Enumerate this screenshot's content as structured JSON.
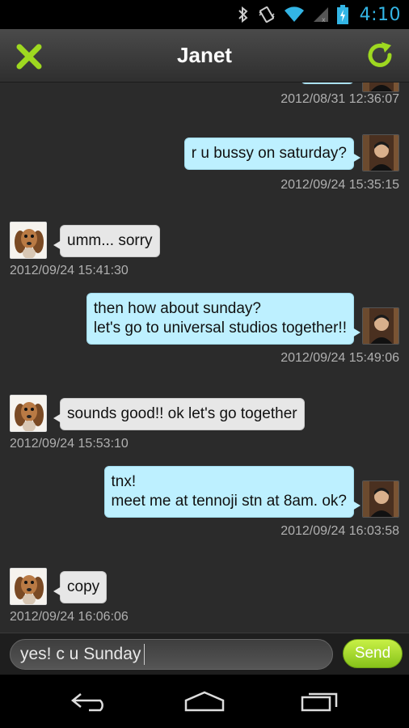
{
  "status_bar": {
    "time": "4:10",
    "icons": [
      "bluetooth-icon",
      "vibrate-icon",
      "wifi-icon",
      "signal-icon",
      "battery-charging-icon"
    ],
    "accent_color": "#33b5e5"
  },
  "header": {
    "title": "Janet",
    "close_icon": "close-icon",
    "refresh_icon": "refresh-icon",
    "icon_color": "#9ed820"
  },
  "messages": [
    {
      "from": "me",
      "lines": [],
      "time": "2012/08/31 12:36:07",
      "partial": true
    },
    {
      "from": "me",
      "lines": [
        "r u bussy on saturday?"
      ],
      "time": "2012/09/24 15:35:15"
    },
    {
      "from": "janet",
      "lines": [
        "umm... sorry"
      ],
      "time": "2012/09/24 15:41:30"
    },
    {
      "from": "me",
      "lines": [
        "then how about sunday?",
        "let's go to universal studios together!!"
      ],
      "time": "2012/09/24 15:49:06"
    },
    {
      "from": "janet",
      "lines": [
        "sounds good!! ok let's go together"
      ],
      "time": "2012/09/24 15:53:10"
    },
    {
      "from": "me",
      "lines": [
        "tnx!",
        "meet me at tennoji stn at 8am. ok?"
      ],
      "time": "2012/09/24 16:03:58"
    },
    {
      "from": "janet",
      "lines": [
        "copy"
      ],
      "time": "2012/09/24 16:06:06"
    }
  ],
  "composer": {
    "value": "yes! c u Sunday",
    "send_label": "Send",
    "send_color": "#9ed820"
  },
  "nav_bar": {
    "buttons": [
      "back-icon",
      "home-icon",
      "recent-apps-icon"
    ]
  }
}
